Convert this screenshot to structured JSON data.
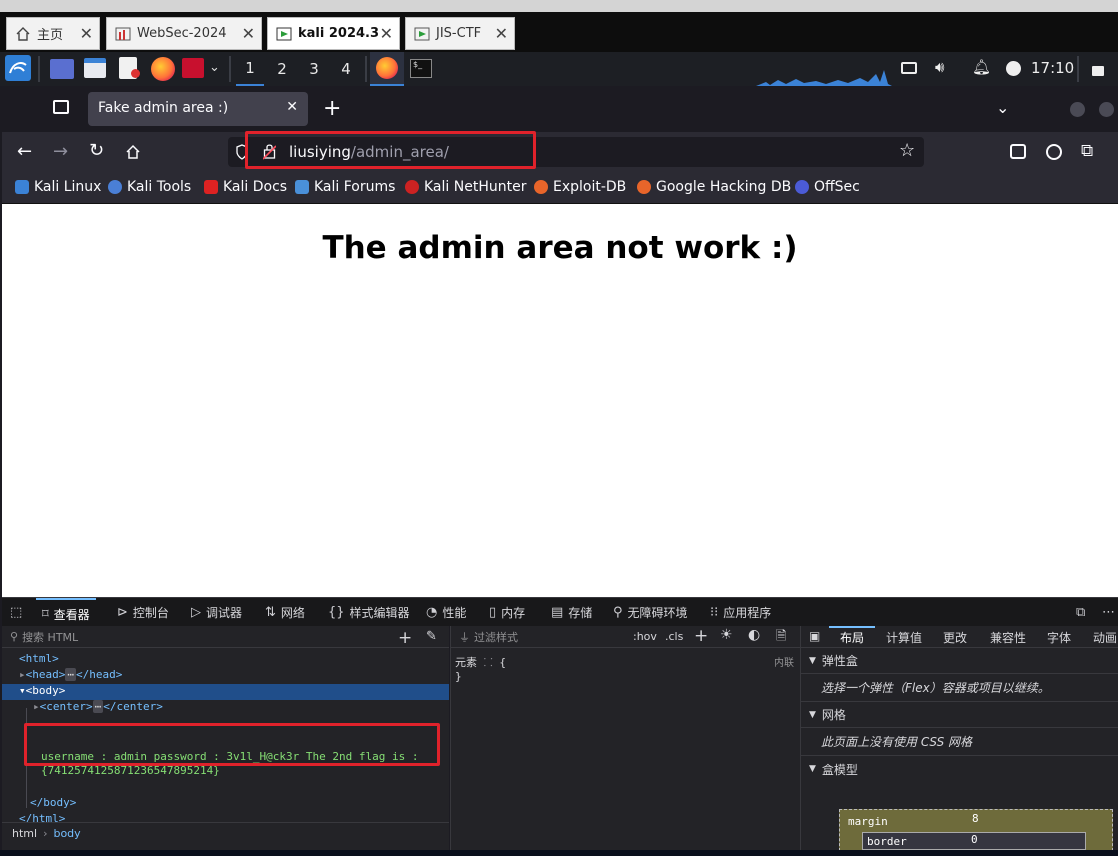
{
  "vm_tabs": [
    {
      "label": "主页",
      "icon": "home-icon"
    },
    {
      "label": "WebSec-2024",
      "icon": "vm-icon"
    },
    {
      "label": "kali 2024.3",
      "icon": "vm-running-icon",
      "active": true
    },
    {
      "label": "JIS-CTF",
      "icon": "vm-running-icon"
    }
  ],
  "panel": {
    "workspaces": [
      "1",
      "2",
      "3",
      "4"
    ],
    "clock": "17:10"
  },
  "browser": {
    "tab_title": "Fake admin area :)",
    "url_host": "liusiying",
    "url_path": "/admin_area/",
    "bookmarks": [
      "Kali Linux",
      "Kali Tools",
      "Kali Docs",
      "Kali Forums",
      "Kali NetHunter",
      "Exploit-DB",
      "Google Hacking DB",
      "OffSec"
    ]
  },
  "page": {
    "heading": "The admin area not work :)"
  },
  "devtools": {
    "tabs": [
      "查看器",
      "控制台",
      "调试器",
      "网络",
      "样式编辑器",
      "性能",
      "内存",
      "存储",
      "无障碍环境",
      "应用程序"
    ],
    "search_placeholder": "搜索 HTML",
    "tree": {
      "html_open": "<html>",
      "head": "<head>",
      "head_close": "</head>",
      "body_open": "<body>",
      "center": "<center>",
      "center_close": "</center>",
      "comment_text": "username : admin password : 3v1l_H@ck3r The 2nd flag is : {7412574125871236547895214}",
      "body_close": "</body>",
      "html_close": "</html>"
    },
    "breadcrumbs": [
      "html",
      "body"
    ],
    "styles": {
      "filter_placeholder": "过滤样式",
      "hov": ":hov",
      "cls": ".cls",
      "rule_selector": "元素",
      "rule_open": "{",
      "rule_close": "}",
      "inline_label": "内联"
    },
    "layout": {
      "tabs": [
        "布局",
        "计算值",
        "更改",
        "兼容性",
        "字体",
        "动画"
      ],
      "flex_section": "弹性盒",
      "flex_text": "选择一个弹性（Flex）容器或项目以继续。",
      "grid_section": "网格",
      "grid_text": "此页面上没有使用 CSS 网格",
      "box_section": "盒模型",
      "margin_label": "margin",
      "margin_value": "8",
      "border_label": "border",
      "border_value": "0"
    }
  }
}
